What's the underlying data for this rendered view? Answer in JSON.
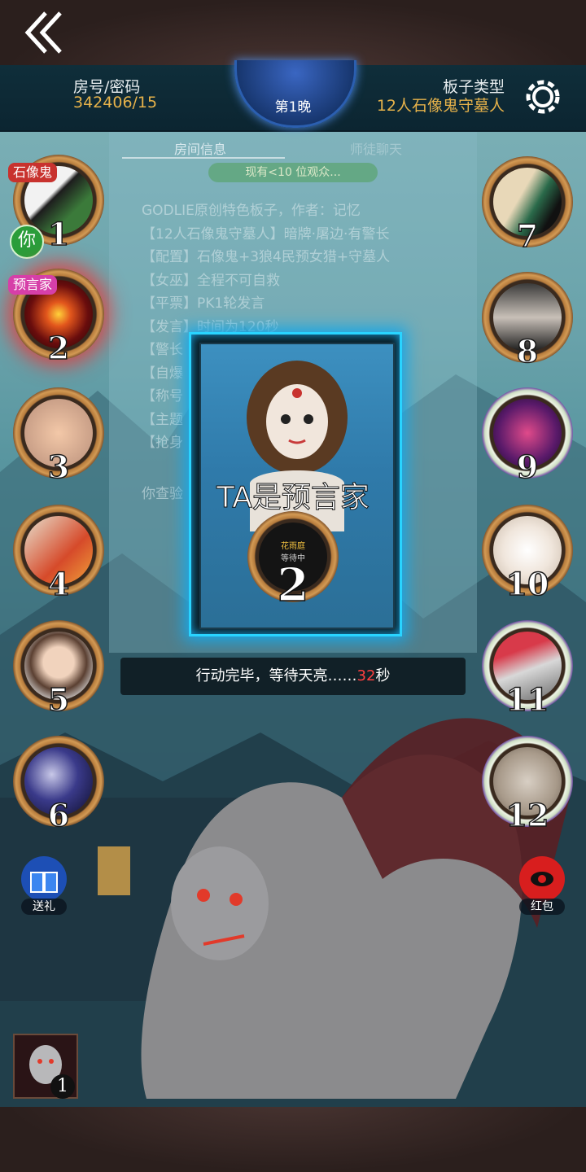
{
  "header": {
    "room_label": "房号/密码",
    "room_code": "342406/15",
    "board_label": "板子类型",
    "board_type": "12人石像鬼守墓人",
    "night": "第1晚"
  },
  "info_panel": {
    "tab_room": "房间信息",
    "tab_chat": "师徒聊天",
    "viewers": "现有<10 位观众...",
    "rules": [
      "GODLIE原创特色板子，作者：记忆",
      "【12人石像鬼守墓人】暗牌·屠边·有警长",
      "【配置】石像鬼+3狼4民预女猎+守墓人",
      "【女巫】全程不可自救",
      "【平票】PK1轮发言",
      "【发言】时间为120秒",
      "【警长",
      "【自爆",
      "【称号",
      "【主题",
      "【抢身"
    ],
    "checked_text": "你查验"
  },
  "seats_left": [
    {
      "num": "1",
      "role_tag": "石像鬼",
      "you": "你"
    },
    {
      "num": "2",
      "role_tag": "预言家"
    },
    {
      "num": "3"
    },
    {
      "num": "4"
    },
    {
      "num": "5"
    },
    {
      "num": "6"
    }
  ],
  "seats_right": [
    {
      "num": "7"
    },
    {
      "num": "8"
    },
    {
      "num": "9"
    },
    {
      "num": "10"
    },
    {
      "num": "11"
    },
    {
      "num": "12"
    }
  ],
  "reveal_card": {
    "text": "TA是预言家",
    "seat_num": "2",
    "mini_tag": "花雨庭",
    "mini_sub": "等待中"
  },
  "status": {
    "prefix": "行动完毕，等待天亮……",
    "seconds": "32",
    "suffix": "秒"
  },
  "buttons": {
    "gift": "送礼",
    "red_packet": "红包"
  },
  "character": {
    "count": "1"
  },
  "colors": {
    "accent_gold": "#e6b24a",
    "card_glow": "#29d4ff",
    "countdown": "#ff4040"
  }
}
